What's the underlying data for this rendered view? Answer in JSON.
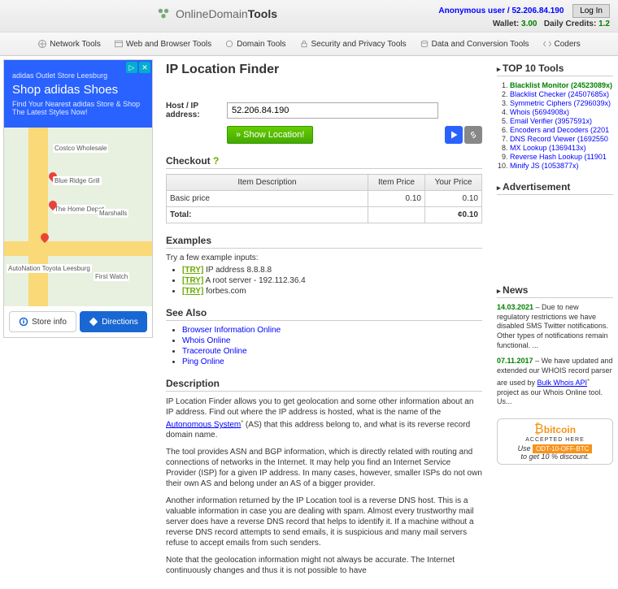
{
  "header": {
    "logo_a": "OnlineDomain",
    "logo_b": "Tools",
    "user_label": "Anonymous user",
    "user_ip": "52.206.84.190",
    "login": "Log In",
    "wallet_label": "Wallet:",
    "wallet_val": "3.00",
    "credits_label": "Daily Credits:",
    "credits_val": "1.2"
  },
  "nav": {
    "network": "Network Tools",
    "web": "Web and Browser Tools",
    "domain": "Domain Tools",
    "security": "Security and Privacy Tools",
    "data": "Data and Conversion Tools",
    "coders": "Coders"
  },
  "ad": {
    "store": "adidas Outlet Store Leesburg",
    "title": "Shop adidas Shoes",
    "sub": "Find Your Nearest adidas Store & Shop The Latest Styles Now!",
    "places": {
      "costco": "Costco Wholesale",
      "blueridge": "Blue Ridge Grill",
      "homedepot": "The Home Depot",
      "marshalls": "Marshalls",
      "autonation": "AutoNation Toyota Leesburg",
      "firstwatch": "First Watch"
    },
    "btn_store": "Store info",
    "btn_dir": "Directions"
  },
  "main": {
    "title": "IP Location Finder",
    "host_label": "Host / IP address:",
    "host_value": "52.206.84.190",
    "show_btn": "» Show Location!",
    "checkout": "Checkout",
    "q": "?",
    "th_desc": "Item Description",
    "th_price": "Item Price",
    "th_your": "Your Price",
    "td_basic": "Basic price",
    "td_price": "0.10",
    "td_your": "0.10",
    "td_total": "Total:",
    "td_total_val": "¢0.10",
    "examples": "Examples",
    "ex_intro": "Try a few example inputs:",
    "try": "[TRY]",
    "ex1": " IP address 8.8.8.8",
    "ex2": " A root server - 192.112.36.4",
    "ex3": " forbes.com",
    "seealso": "See Also",
    "sa1": "Browser Information Online",
    "sa2": "Whois Online",
    "sa3": "Traceroute Online",
    "sa4": "Ping Online",
    "description": "Description",
    "p1a": "IP Location Finder allows you to get geolocation and some other information about an IP address. Find out where the IP address is hosted, what is the name of the ",
    "p1link": "Autonomous System",
    "p1b": " (AS) that this address belong to, and what is its reverse record domain name.",
    "p2": "The tool provides ASN and BGP information, which is directly related with routing and connections of networks in the Internet. It may help you find an Internet Service Provider (ISP) for a given IP address. In many cases, however, smaller ISPs do not own their own AS and belong under an AS of a bigger provider.",
    "p3": "Another information returned by the IP Location tool is a reverse DNS host. This is a valuable information in case you are dealing with spam. Almost every trustworthy mail server does have a reverse DNS record that helps to identify it. If a machine without a reverse DNS record attempts to send emails, it is suspicious and many mail servers refuse to accept emails from such senders.",
    "p4": "Note that the geolocation information might not always be accurate. The Internet continuously changes and thus it is not possible to have"
  },
  "sidebar": {
    "top10": "TOP 10 Tools",
    "t1": "Blacklist Monitor (24523089x)",
    "t2": "Blacklist Checker (24507685x)",
    "t3": "Symmetric Ciphers (7296039x)",
    "t4": "Whois (5694908x)",
    "t5": "Email Verifier (3957591x)",
    "t6": "Encoders and Decoders (2201",
    "t7": "DNS Record Viewer (1692550",
    "t8": "MX Lookup (1369413x)",
    "t9": "Reverse Hash Lookup (11901",
    "t10": "Minify JS (1053877x)",
    "adv": "Advertisement",
    "news": "News",
    "n1_date": "14.03.2021",
    "n1_text": " – Due to new regulatory restrictions we have disabled SMS Twitter notifications. Other types of notifications remain functional. ...",
    "n2_date": "07.11.2017",
    "n2_text_a": " – We have updated and extended our WHOIS record parser are used by ",
    "n2_link": "Bulk Whois API",
    "n2_text_b": " project as our Whois Online tool. Us...",
    "btc_brand": "bitcoin",
    "btc_accept": "ACCEPTED HERE",
    "btc_use": "Use ",
    "btc_code": "ODT-10-OFF-BTC",
    "btc_disc": "to get 10 % discount."
  }
}
